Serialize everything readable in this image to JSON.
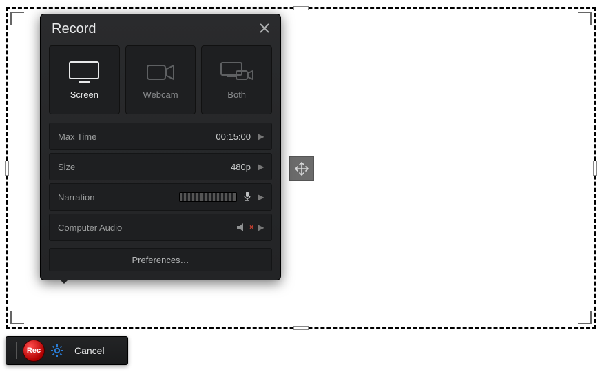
{
  "popover": {
    "title": "Record",
    "sources": [
      {
        "label": "Screen",
        "active": true
      },
      {
        "label": "Webcam",
        "active": false
      },
      {
        "label": "Both",
        "active": false
      }
    ],
    "rows": {
      "maxTime": {
        "label": "Max Time",
        "value": "00:15:00"
      },
      "size": {
        "label": "Size",
        "value": "480p"
      },
      "narration": {
        "label": "Narration"
      },
      "computerAudio": {
        "label": "Computer Audio",
        "muted": true
      }
    },
    "preferences": "Preferences…"
  },
  "toolbar": {
    "rec_label": "Rec",
    "cancel_label": "Cancel"
  }
}
